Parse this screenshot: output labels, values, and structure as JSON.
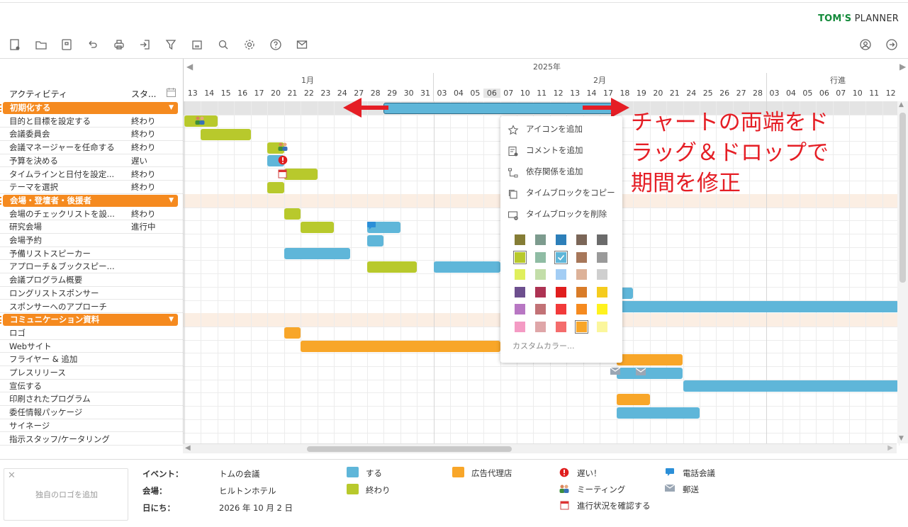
{
  "brand": {
    "part1": "TOM'S",
    "part2": "PLANNER"
  },
  "toolbar": {
    "left_icons": [
      "new-document-icon",
      "folder-icon",
      "save-icon",
      "undo-icon",
      "print-icon",
      "export-icon",
      "filter-icon",
      "view-icon",
      "search-icon",
      "settings-icon",
      "help-icon",
      "mail-icon"
    ],
    "right_icons": [
      "user-icon",
      "logout-icon"
    ]
  },
  "columns": {
    "activity": "アクティビティ",
    "status": "スタ...",
    "calendar_icon": "calendar-icon"
  },
  "timeline": {
    "year": "2025年",
    "months": [
      "1月",
      "2月",
      "行進"
    ],
    "days": [
      "13",
      "14",
      "15",
      "16",
      "17",
      "20",
      "21",
      "22",
      "23",
      "24",
      "27",
      "28",
      "29",
      "30",
      "31",
      "03",
      "04",
      "05",
      "06",
      "07",
      "10",
      "11",
      "12",
      "13",
      "14",
      "17",
      "18",
      "19",
      "20",
      "21",
      "24",
      "25",
      "26",
      "27",
      "28",
      "03",
      "04",
      "05",
      "06",
      "07",
      "10",
      "11",
      "12"
    ]
  },
  "rows": [
    {
      "type": "group",
      "label": "初期化する"
    },
    {
      "type": "task",
      "label": "目的と目標を設定する",
      "status": "終わり"
    },
    {
      "type": "task",
      "label": "会議委員会",
      "status": "終わり"
    },
    {
      "type": "task",
      "label": "会議マネージャーを任命する",
      "status": "終わり"
    },
    {
      "type": "task",
      "label": "予算を決める",
      "status": "遅い"
    },
    {
      "type": "task",
      "label": "タイムラインと日付を設定...",
      "status": "終わり"
    },
    {
      "type": "task",
      "label": "テーマを選択",
      "status": "終わり"
    },
    {
      "type": "group",
      "label": "会場・登壇者・後援者"
    },
    {
      "type": "task",
      "label": "会場のチェックリストを設...",
      "status": "終わり"
    },
    {
      "type": "task",
      "label": "研究会場",
      "status": "進行中"
    },
    {
      "type": "task",
      "label": "会場予約",
      "status": ""
    },
    {
      "type": "task",
      "label": "予備リストスピーカー",
      "status": ""
    },
    {
      "type": "task",
      "label": "アプローチ＆ブックスピー...",
      "status": ""
    },
    {
      "type": "task",
      "label": "会議プログラム概要",
      "status": ""
    },
    {
      "type": "task",
      "label": "ロングリストスポンサー",
      "status": ""
    },
    {
      "type": "task",
      "label": "スポンサーへのアプローチ",
      "status": ""
    },
    {
      "type": "group",
      "label": "コミュニケーション資料"
    },
    {
      "type": "task",
      "label": "ロゴ",
      "status": ""
    },
    {
      "type": "task",
      "label": "Webサイト",
      "status": ""
    },
    {
      "type": "task",
      "label": "フライヤー & 追加",
      "status": ""
    },
    {
      "type": "task",
      "label": "プレスリリース",
      "status": ""
    },
    {
      "type": "task",
      "label": "宣伝する",
      "status": ""
    },
    {
      "type": "task",
      "label": "印刷されたプログラム",
      "status": ""
    },
    {
      "type": "task",
      "label": "委任情報パッケージ",
      "status": ""
    },
    {
      "type": "task",
      "label": "サイネージ",
      "status": ""
    },
    {
      "type": "task",
      "label": "指示スタッフ/ケータリング",
      "status": ""
    }
  ],
  "bars": [
    {
      "row": 0,
      "start": 12,
      "end": 26,
      "color": "#5fb6d9",
      "selected": true
    },
    {
      "row": 1,
      "start": 0,
      "end": 2,
      "color": "#b8c92c",
      "icon": "meeting-icon"
    },
    {
      "row": 2,
      "start": 1,
      "end": 4,
      "color": "#b8c92c"
    },
    {
      "row": 3,
      "start": 5,
      "end": 6,
      "color": "#b8c92c",
      "icon": "meeting-icon"
    },
    {
      "row": 4,
      "start": 5,
      "end": 6,
      "color": "#5fb6d9",
      "icon": "late-icon"
    },
    {
      "row": 5,
      "start": 6,
      "end": 8,
      "color": "#b8c92c",
      "icon": "progress-check-icon"
    },
    {
      "row": 6,
      "start": 5,
      "end": 6,
      "color": "#b8c92c"
    },
    {
      "row": 8,
      "start": 6,
      "end": 7,
      "color": "#b8c92c"
    },
    {
      "row": 9,
      "start": 7,
      "end": 9,
      "color": "#b8c92c"
    },
    {
      "row": 9,
      "start": 11,
      "end": 13,
      "color": "#5fb6d9",
      "icon": "phone-call-icon"
    },
    {
      "row": 10,
      "start": 11,
      "end": 12,
      "color": "#5fb6d9"
    },
    {
      "row": 11,
      "start": 6,
      "end": 10,
      "color": "#5fb6d9"
    },
    {
      "row": 12,
      "start": 11,
      "end": 14,
      "color": "#b8c92c"
    },
    {
      "row": 12,
      "start": 15,
      "end": 19,
      "color": "#5fb6d9"
    },
    {
      "row": 14,
      "start": 25,
      "end": 27,
      "color": "#5fb6d9"
    },
    {
      "row": 15,
      "start": 25,
      "end": 43,
      "color": "#5fb6d9"
    },
    {
      "row": 17,
      "start": 6,
      "end": 7,
      "color": "#f8a629"
    },
    {
      "row": 18,
      "start": 7,
      "end": 19,
      "color": "#f8a629"
    },
    {
      "row": 19,
      "start": 26,
      "end": 30,
      "color": "#f8a629"
    },
    {
      "row": 20,
      "start": 26,
      "end": 30,
      "color": "#5fb6d9",
      "icon": "mail-icon"
    },
    {
      "row": 21,
      "start": 30,
      "end": 43,
      "color": "#5fb6d9"
    },
    {
      "row": 22,
      "start": 26,
      "end": 28,
      "color": "#f8a629"
    },
    {
      "row": 23,
      "start": 26,
      "end": 31,
      "color": "#5fb6d9"
    }
  ],
  "annotation": {
    "line1": "チャートの両端をド",
    "line2": "ラッグ＆ドロップで",
    "line3": "期間を修正"
  },
  "context_menu": {
    "items": [
      {
        "label": "アイコンを追加",
        "icon": "star-add-icon"
      },
      {
        "label": "コメントを追加",
        "icon": "comment-add-icon"
      },
      {
        "label": "依存関係を追加",
        "icon": "dependency-icon"
      },
      {
        "label": "タイムブロックをコピー",
        "icon": "copy-icon"
      },
      {
        "label": "タイムブロックを削除",
        "icon": "delete-block-icon"
      }
    ],
    "swatches": [
      [
        "#857d35",
        "#7d9b8e",
        "#2d7fb9",
        "#7b6658",
        "#6b6b6b"
      ],
      [
        "#b8c92c",
        "#8fbca4",
        "#5fb6d9",
        "#a7775a",
        "#9a9a9a"
      ],
      [
        "#e0ef5c",
        "#c3dea9",
        "#a3cdf4",
        "#ddb299",
        "#cfcfcf"
      ],
      [
        "#6d4f8e",
        "#ad3353",
        "#e01e1e",
        "#d97c28",
        "#f5cc1e"
      ],
      [
        "#b877c3",
        "#c27276",
        "#f23a3a",
        "#f58a1f",
        "#fff21e"
      ],
      [
        "#f49bc4",
        "#dfa6a8",
        "#f46c6c",
        "#f8a629",
        "#fbf69c"
      ]
    ],
    "selected_swatch": "#5fb6d9",
    "custom": "カスタムカラー..."
  },
  "footer": {
    "logo_placeholder": "独自のロゴを追加",
    "info": [
      {
        "key": "イベント：",
        "value": "トムの会議"
      },
      {
        "key": "会場：",
        "value": "ヒルトンホテル"
      },
      {
        "key": "日にち：",
        "value": "2026 年 10 月 2 日"
      }
    ],
    "legend_colors": [
      {
        "label": "する",
        "color": "#5fb6d9"
      },
      {
        "label": "終わり",
        "color": "#b8c92c"
      },
      {
        "label": "広告代理店",
        "color": "#f8a629"
      }
    ],
    "legend_icons": [
      {
        "label": "遅い！",
        "icon": "late-icon"
      },
      {
        "label": "ミーティング",
        "icon": "meeting-icon"
      },
      {
        "label": "進行状況を確認する",
        "icon": "progress-check-icon"
      },
      {
        "label": "電話会議",
        "icon": "phone-call-icon"
      },
      {
        "label": "郵送",
        "icon": "mail-icon"
      }
    ]
  }
}
